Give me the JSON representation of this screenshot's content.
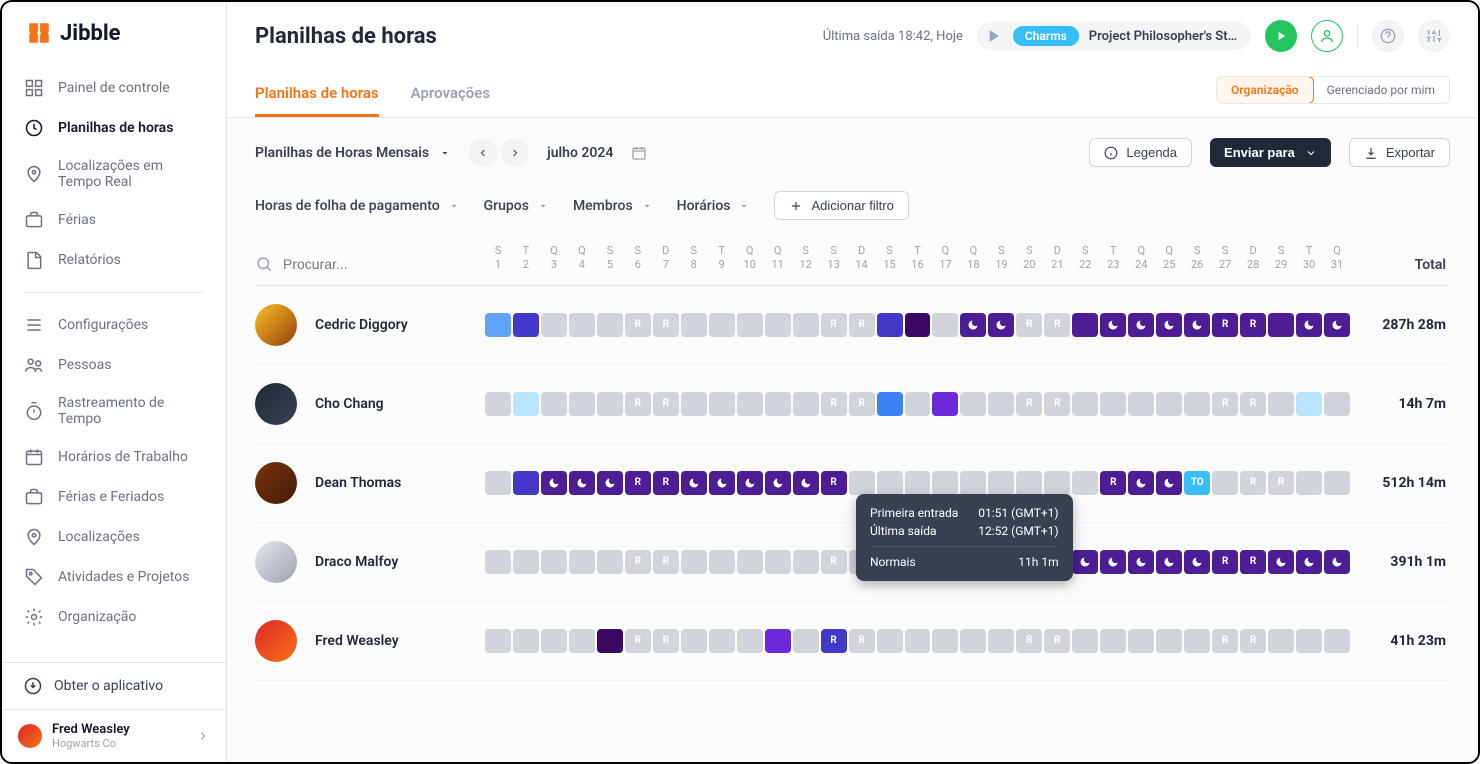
{
  "brand": "Jibble",
  "page_title": "Planilhas de horas",
  "topbar": {
    "last_out": "Última saída 18:42, Hoje",
    "chip": "Charms",
    "project": "Project Philosopher's St…"
  },
  "sidebar": {
    "items": [
      {
        "label": "Painel de controle",
        "icon": "grid"
      },
      {
        "label": "Planilhas de horas",
        "icon": "clock",
        "active": true
      },
      {
        "label": "Localizações em Tempo Real",
        "icon": "pin"
      },
      {
        "label": "Férias",
        "icon": "briefcase"
      },
      {
        "label": "Relatórios",
        "icon": "doc"
      }
    ],
    "items2": [
      {
        "label": "Configurações",
        "icon": "sliders"
      },
      {
        "label": "Pessoas",
        "icon": "people"
      },
      {
        "label": "Rastreamento de Tempo",
        "icon": "stopwatch"
      },
      {
        "label": "Horários de Trabalho",
        "icon": "calendar"
      },
      {
        "label": "Férias e Feriados",
        "icon": "briefcase"
      },
      {
        "label": "Localizações",
        "icon": "pin"
      },
      {
        "label": "Atividades e Projetos",
        "icon": "tag"
      },
      {
        "label": "Organização",
        "icon": "gear"
      }
    ],
    "download": "Obter o aplicativo",
    "user_name": "Fred Weasley",
    "user_org": "Hogwarts Co"
  },
  "tabs": {
    "t1": "Planilhas de horas",
    "t2": "Aprovações"
  },
  "scope": {
    "org": "Organização",
    "mine": "Gerenciado por mim"
  },
  "controls": {
    "period": "Planilhas de Horas Mensais",
    "month": "julho 2024",
    "legend": "Legenda",
    "send": "Enviar para",
    "export": "Exportar"
  },
  "filters": {
    "f1": "Horas de folha de pagamento",
    "f2": "Grupos",
    "f3": "Membros",
    "f4": "Horários",
    "add": "Adicionar filtro"
  },
  "table": {
    "search_placeholder": "Procurar...",
    "total_label": "Total",
    "dows": [
      "S",
      "T",
      "Q",
      "Q",
      "S",
      "S",
      "D",
      "S",
      "T",
      "Q",
      "Q",
      "S",
      "S",
      "D",
      "S",
      "T",
      "Q",
      "Q",
      "S",
      "S",
      "D",
      "S",
      "T",
      "Q",
      "Q",
      "S",
      "S",
      "D",
      "S",
      "T",
      "Q"
    ],
    "days": [
      "1",
      "2",
      "3",
      "4",
      "5",
      "6",
      "7",
      "8",
      "9",
      "10",
      "11",
      "12",
      "13",
      "14",
      "15",
      "16",
      "17",
      "18",
      "19",
      "20",
      "21",
      "22",
      "23",
      "24",
      "25",
      "26",
      "27",
      "28",
      "29",
      "30",
      "31"
    ]
  },
  "members": [
    {
      "name": "Cedric Diggory",
      "avatar": "av1",
      "total": "287h 28m",
      "cells": [
        "skyblue",
        "indigo",
        "gray",
        "gray",
        "gray",
        "grayR",
        "grayR",
        "gray",
        "gray",
        "gray",
        "gray",
        "gray",
        "grayR",
        "grayR",
        "indigo",
        "darkpurple",
        "gray",
        "moon-purple",
        "moon-purple",
        "grayR",
        "grayR",
        "purple",
        "moon-purple",
        "moon-purple",
        "moon-purple",
        "moon-purple",
        "purpleR",
        "purpleR",
        "purple",
        "moon-purple",
        "moon-purple"
      ]
    },
    {
      "name": "Cho Chang",
      "avatar": "av2",
      "total": "14h 7m",
      "cells": [
        "gray",
        "lightsky",
        "gray",
        "gray",
        "gray",
        "grayR",
        "grayR",
        "gray",
        "gray",
        "gray",
        "gray",
        "gray",
        "grayR",
        "grayR",
        "blue",
        "gray",
        "violet",
        "gray",
        "gray",
        "grayR",
        "grayR",
        "gray",
        "gray",
        "gray",
        "gray",
        "gray",
        "grayR",
        "grayR",
        "gray",
        "lightsky",
        "gray"
      ]
    },
    {
      "name": "Dean Thomas",
      "avatar": "av3",
      "total": "512h 14m",
      "cells": [
        "gray",
        "indigo",
        "moon-purple",
        "moon-purple",
        "moon-purple",
        "purpleR",
        "purpleR",
        "moon-purple",
        "moon-purple",
        "moon-purple",
        "moon-purple",
        "moon-purple",
        "purpleR",
        "",
        "",
        "",
        "",
        "",
        "",
        "",
        "",
        "",
        "purpleR",
        "moon-purple",
        "moon-purple",
        "to",
        "gray",
        "grayR",
        "grayR",
        "gray",
        "gray"
      ]
    },
    {
      "name": "Draco Malfoy",
      "avatar": "av4",
      "total": "391h 1m",
      "cells": [
        "gray",
        "gray",
        "gray",
        "gray",
        "gray",
        "grayR",
        "grayR",
        "gray",
        "gray",
        "gray",
        "gray",
        "gray",
        "grayR",
        "grayR",
        "indigo",
        "moon-purple",
        "moon-purple",
        "moon-purple",
        "moon-purple",
        "purpleR",
        "purpleR",
        "moon-purple",
        "moon-purple",
        "moon-purple",
        "moon-purple",
        "moon-purple",
        "purpleR",
        "purpleR",
        "moon-purple",
        "moon-purple",
        "moon-purple"
      ]
    },
    {
      "name": "Fred Weasley",
      "avatar": "av5",
      "total": "41h 23m",
      "cells": [
        "gray",
        "gray",
        "gray",
        "gray",
        "darkpurple",
        "grayR",
        "grayR",
        "gray",
        "gray",
        "gray",
        "violet",
        "gray",
        "indigoR",
        "grayR",
        "gray",
        "gray",
        "gray",
        "gray",
        "gray",
        "grayR",
        "grayR",
        "gray",
        "gray",
        "gray",
        "gray",
        "gray",
        "grayR",
        "grayR",
        "gray",
        "gray",
        "gray"
      ]
    }
  ],
  "tooltip": {
    "first_in_label": "Primeira entrada",
    "first_in_val": "01:51 (GMT+1)",
    "last_out_label": "Última saída",
    "last_out_val": "12:52 (GMT+1)",
    "normal_label": "Normais",
    "normal_val": "11h 1m"
  }
}
